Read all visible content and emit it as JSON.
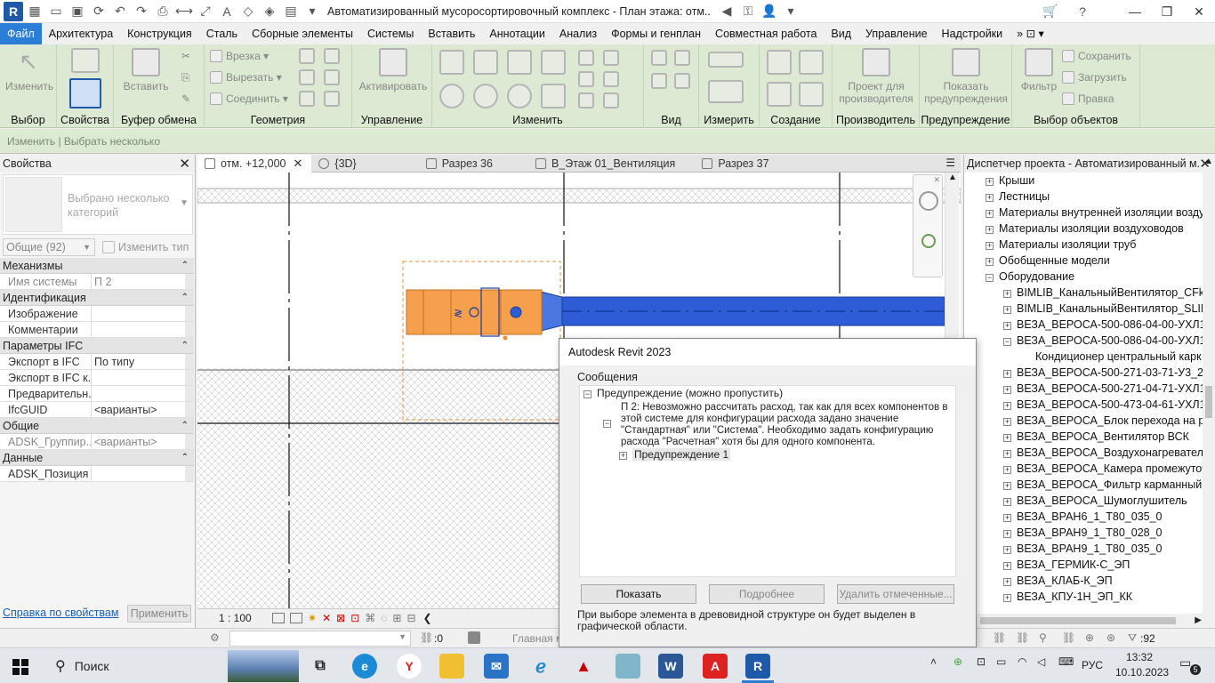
{
  "titlebar": {
    "title": "Автоматизированный мусоросортировочный комплекс - План этажа: отм...",
    "logo_letter": "R"
  },
  "menu": {
    "tabs": [
      "Файл",
      "Архитектура",
      "Конструкция",
      "Сталь",
      "Сборные элементы",
      "Системы",
      "Вставить",
      "Аннотации",
      "Анализ",
      "Формы и генплан",
      "Совместная работа",
      "Вид",
      "Управление",
      "Надстройки"
    ]
  },
  "ribbon": {
    "modify_label": "Изменить",
    "insert_label": "Вставить",
    "activate_label": "Активировать",
    "cut_label": "Врезка",
    "cutout_label": "Вырезать",
    "join_label": "Соединить",
    "producer_project_label": "Проект для производителя",
    "show_warning_label": "Показать предупреждения",
    "filter_label": "Фильтр",
    "save_label": "Сохранить",
    "load_label": "Загрузить",
    "edit_label": "Правка",
    "groups": {
      "select": "Выбор",
      "properties": "Свойства",
      "clipboard": "Буфер обмена",
      "geometry": "Геометрия",
      "control": "Управление",
      "modify": "Изменить",
      "view": "Вид",
      "measure": "Измерить",
      "create": "Создание",
      "manufacturer": "Производитель",
      "warning": "Предупреждение",
      "selection": "Выбор объектов"
    }
  },
  "optionsbar": {
    "text": "Изменить | Выбрать несколько"
  },
  "properties": {
    "title": "Свойства",
    "type_text": "Выбрано несколько категорий",
    "filter_value": "Общие (92)",
    "edit_type": "Изменить тип",
    "categories": [
      {
        "name": "Механизмы",
        "rows": [
          {
            "key": "Имя системы",
            "value": "П 2",
            "dim": true
          }
        ]
      },
      {
        "name": "Идентификация",
        "rows": [
          {
            "key": "Изображение",
            "value": ""
          },
          {
            "key": "Комментарии",
            "value": ""
          }
        ]
      },
      {
        "name": "Параметры IFC",
        "rows": [
          {
            "key": "Экспорт в IFC",
            "value": "По типу"
          },
          {
            "key": "Экспорт в IFC к...",
            "value": ""
          },
          {
            "key": "Предварительн...",
            "value": ""
          },
          {
            "key": "IfcGUID",
            "value": "<варианты>"
          }
        ]
      },
      {
        "name": "Общие",
        "rows": [
          {
            "key": "ADSK_Группир...",
            "value": "<варианты>",
            "dim": true
          }
        ]
      },
      {
        "name": "Данные",
        "rows": [
          {
            "key": "ADSK_Позиция",
            "value": ""
          }
        ]
      }
    ],
    "help_link": "Справка по свойствам",
    "apply": "Применить"
  },
  "view_tabs": [
    {
      "label": "отм. +12,000",
      "active": true
    },
    {
      "label": "{3D}"
    },
    {
      "label": "Разрез 36"
    },
    {
      "label": "В_Этаж 01_Вентиляция"
    },
    {
      "label": "Разрез 37"
    }
  ],
  "viewbar": {
    "scale": "1 : 100"
  },
  "browser": {
    "title": "Диспетчер проекта - Автоматизированный м...",
    "items": [
      {
        "label": "Крыши",
        "level": 1,
        "exp": "+"
      },
      {
        "label": "Лестницы",
        "level": 1,
        "exp": "+"
      },
      {
        "label": "Материалы внутренней изоляции возду",
        "level": 1,
        "exp": "+"
      },
      {
        "label": "Материалы изоляции воздуховодов",
        "level": 1,
        "exp": "+"
      },
      {
        "label": "Материалы изоляции труб",
        "level": 1,
        "exp": "+"
      },
      {
        "label": "Обобщенные модели",
        "level": 1,
        "exp": "+"
      },
      {
        "label": "Оборудование",
        "level": 1,
        "exp": "−"
      },
      {
        "label": "BIMLIB_КанальныйВентилятор_CFk-N",
        "level": 2,
        "exp": "+"
      },
      {
        "label": "BIMLIB_КанальныйВентилятор_SLIM_",
        "level": 2,
        "exp": "+"
      },
      {
        "label": "ВЕЗА_ВЕРОСА-500-086-04-00-УХЛ1",
        "level": 2,
        "exp": "+"
      },
      {
        "label": "ВЕЗА_ВЕРОСА-500-086-04-00-УХЛ1",
        "level": 2,
        "exp": "−"
      },
      {
        "label": "Кондиционер центральный карк",
        "level": 3,
        "exp": ""
      },
      {
        "label": "ВЕЗА_ВЕРОСА-500-271-03-71-У3_2",
        "level": 2,
        "exp": "+"
      },
      {
        "label": "ВЕЗА_ВЕРОСА-500-271-04-71-УХЛ1",
        "level": 2,
        "exp": "+"
      },
      {
        "label": "ВЕЗА_ВЕРОСА-500-473-04-61-УХЛ1",
        "level": 2,
        "exp": "+"
      },
      {
        "label": "ВЕЗА_ВЕРОСА_Блок перехода на рез",
        "level": 2,
        "exp": "+"
      },
      {
        "label": "ВЕЗА_ВЕРОСА_Вентилятор ВСК",
        "level": 2,
        "exp": "+"
      },
      {
        "label": "ВЕЗА_ВЕРОСА_Воздухонагреватель х",
        "level": 2,
        "exp": "+"
      },
      {
        "label": "ВЕЗА_ВЕРОСА_Камера промежуточн",
        "level": 2,
        "exp": "+"
      },
      {
        "label": "ВЕЗА_ВЕРОСА_Фильтр карманный кл",
        "level": 2,
        "exp": "+"
      },
      {
        "label": "ВЕЗА_ВЕРОСА_Шумоглушитель",
        "level": 2,
        "exp": "+"
      },
      {
        "label": "ВЕЗА_ВРАН6_1_Т80_035_0",
        "level": 2,
        "exp": "+"
      },
      {
        "label": "ВЕЗА_ВРАН9_1_Т80_028_0",
        "level": 2,
        "exp": "+"
      },
      {
        "label": "ВЕЗА_ВРАН9_1_Т80_035_0",
        "level": 2,
        "exp": "+"
      },
      {
        "label": "ВЕЗА_ГЕРМИК-С_ЭП",
        "level": 2,
        "exp": "+"
      },
      {
        "label": "ВЕЗА_КЛАБ-К_ЭП",
        "level": 2,
        "exp": "+"
      },
      {
        "label": "ВЕЗА_КПУ-1Н_ЭП_КК",
        "level": 2,
        "exp": "+"
      }
    ]
  },
  "statusbar": {
    "counter": ":0",
    "model": "Главная м",
    "selection_count": ":92"
  },
  "dialog": {
    "title": "Autodesk Revit 2023",
    "group_label": "Сообщения",
    "warning_root": "Предупреждение (можно пропустить)",
    "message": "П 2: Невозможно рассчитать расход, так как для всех компонентов в этой системе для конфигурации расхода задано значение \"Стандартная\" или \"Система\". Необходимо задать конфигурацию расхода \"Расчетная\" хотя бы для одного компонента.",
    "warning_child": "Предупреждение 1",
    "btn_show": "Показать",
    "btn_more": "Подробнее",
    "btn_delete": "Удалить отмеченные...",
    "info": "При выборе элемента в древовидной структуре он будет выделен в графической области."
  },
  "taskbar": {
    "search": "Поиск",
    "lang": "РУС",
    "time": "13:32",
    "date": "10.10.2023",
    "notifications": "5"
  },
  "colors": {
    "accent": "#2b7dd6",
    "ribbon": "#dce9d3",
    "duct": "#2d5cd6",
    "equipment": "#f6a04d"
  }
}
